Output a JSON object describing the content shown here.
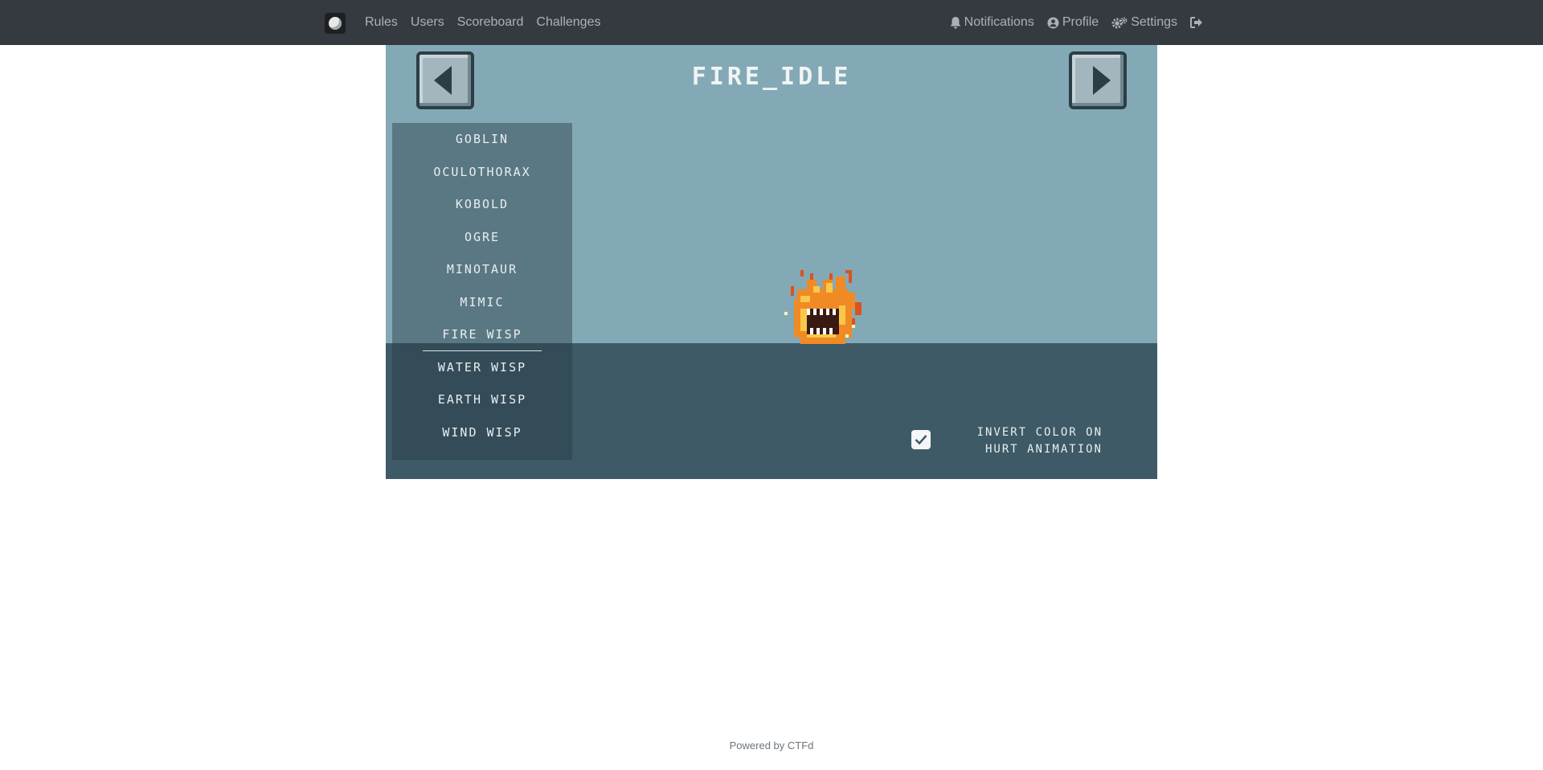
{
  "nav": {
    "left_items": [
      {
        "label": "Rules"
      },
      {
        "label": "Users"
      },
      {
        "label": "Scoreboard"
      },
      {
        "label": "Challenges"
      }
    ],
    "right_items": [
      {
        "label": "Notifications",
        "icon": "bell-icon"
      },
      {
        "label": "Profile",
        "icon": "user-circle-icon"
      },
      {
        "label": "Settings",
        "icon": "cogs-icon"
      }
    ]
  },
  "game": {
    "title": "FIRE_IDLE",
    "monsters": [
      {
        "label": "GOBLIN"
      },
      {
        "label": "OCULOTHORAX"
      },
      {
        "label": "KOBOLD"
      },
      {
        "label": "OGRE"
      },
      {
        "label": "MINOTAUR"
      },
      {
        "label": "MIMIC"
      },
      {
        "label": "FIRE WISP",
        "selected": true
      },
      {
        "label": "WATER WISP"
      },
      {
        "label": "EARTH WISP"
      },
      {
        "label": "WIND WISP"
      }
    ],
    "invert_line1": "INVERT COLOR ON",
    "invert_line2": "HURT ANIMATION",
    "invert_checked": true
  },
  "footer": {
    "text": "Powered by CTFd"
  },
  "colors": {
    "navbar": "#343a40",
    "sky": "#84a9b6",
    "ground": "#3d5a66"
  }
}
